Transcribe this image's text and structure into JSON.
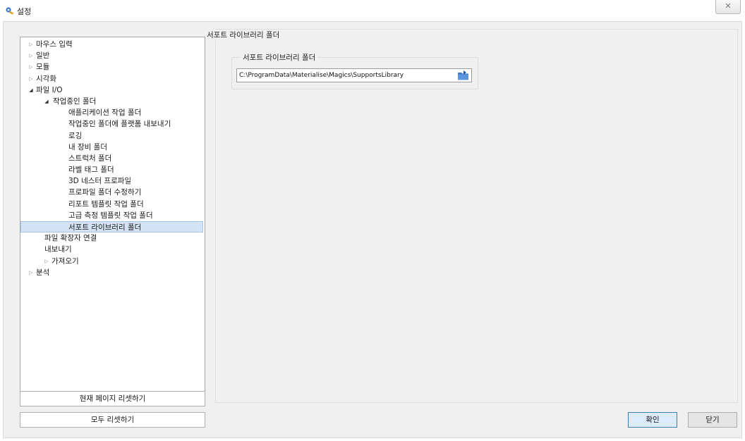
{
  "window": {
    "title": "설정",
    "close_glyph": "✕"
  },
  "tree": [
    {
      "label": "마우스 입력",
      "expander": "▷"
    },
    {
      "label": "일반",
      "expander": "▷"
    },
    {
      "label": "모듈",
      "expander": "▷"
    },
    {
      "label": "시각화",
      "expander": "▷"
    },
    {
      "label": "파일 I/O",
      "expander": "◢"
    },
    {
      "label": "작업중인 폴더",
      "expander": "◢"
    },
    {
      "label": "애플리케이션 작업 폴더",
      "expander": ""
    },
    {
      "label": "작업중인 폴더에 플랫폼 내보내기",
      "expander": ""
    },
    {
      "label": "로깅",
      "expander": ""
    },
    {
      "label": "내 장비 폴더",
      "expander": ""
    },
    {
      "label": "스트럭처 폴더",
      "expander": ""
    },
    {
      "label": "라벨 태그 폴더",
      "expander": ""
    },
    {
      "label": "3D 네스터 프로파일",
      "expander": ""
    },
    {
      "label": "프로파일 폴더 수정하기",
      "expander": ""
    },
    {
      "label": "리포트 템플릿 작업 폴더",
      "expander": ""
    },
    {
      "label": "고급 측정 템플릿 작업 폴더",
      "expander": ""
    },
    {
      "label": "서포트 라이브러리 폴더",
      "expander": ""
    },
    {
      "label": "파일 확장자 연결",
      "expander": ""
    },
    {
      "label": "내보내기",
      "expander": ""
    },
    {
      "label": "가져오기",
      "expander": "▷"
    },
    {
      "label": "분석",
      "expander": "▷"
    }
  ],
  "buttons": {
    "reset_page": "현재 페이지 리셋하기",
    "reset_all": "모두 리셋하기",
    "ok": "확인",
    "close": "닫기"
  },
  "right_panel": {
    "section_title": "서포트 라이브러리 폴더",
    "group_title": "서포트 라이브러리 폴더",
    "path_value": "C:\\ProgramData\\Materialise\\Magics\\SupportsLibrary"
  },
  "colors": {
    "selected_row": "#d3e2f5",
    "folder_icon": "#3a78c9",
    "primary_button_border": "#3c7fb1"
  }
}
